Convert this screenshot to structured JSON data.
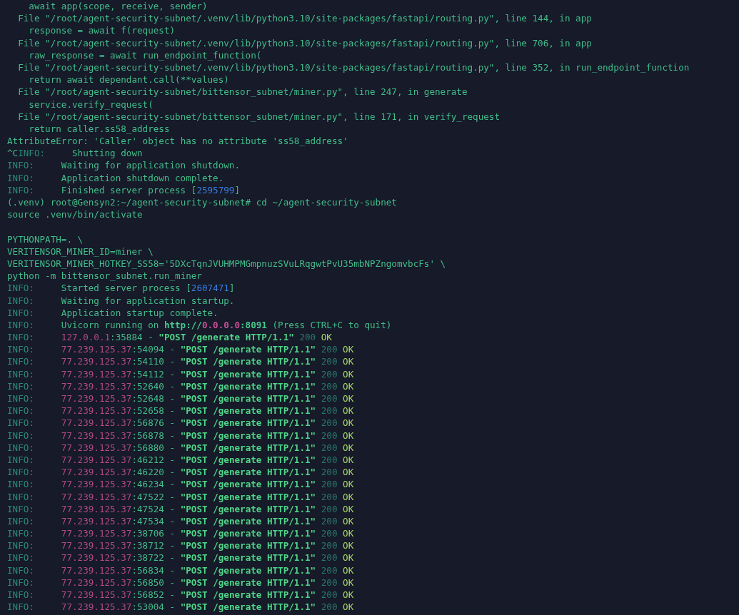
{
  "terminal": {
    "lines": [
      {
        "kind": "output",
        "segments": [
          {
            "kind": "text",
            "text": "    await app(scope, receive, sender)"
          }
        ]
      },
      {
        "kind": "output",
        "segments": [
          {
            "kind": "text",
            "text": "  File \"/root/agent-security-subnet/.venv/lib/python3.10/site-packages/fastapi/routing.py\", line 144, in app"
          }
        ]
      },
      {
        "kind": "output",
        "segments": [
          {
            "kind": "text",
            "text": "    response = await f(request)"
          }
        ]
      },
      {
        "kind": "output",
        "segments": [
          {
            "kind": "text",
            "text": "  File \"/root/agent-security-subnet/.venv/lib/python3.10/site-packages/fastapi/routing.py\", line 706, in app"
          }
        ]
      },
      {
        "kind": "output",
        "segments": [
          {
            "kind": "text",
            "text": "    raw_response = await run_endpoint_function("
          }
        ]
      },
      {
        "kind": "output",
        "segments": [
          {
            "kind": "text",
            "text": "  File \"/root/agent-security-subnet/.venv/lib/python3.10/site-packages/fastapi/routing.py\", line 352, in run_endpoint_function"
          }
        ]
      },
      {
        "kind": "output",
        "segments": [
          {
            "kind": "text",
            "text": "    return await dependant.call(**values)"
          }
        ]
      },
      {
        "kind": "output",
        "segments": [
          {
            "kind": "text",
            "text": "  File \"/root/agent-security-subnet/bittensor_subnet/miner.py\", line 247, in generate"
          }
        ]
      },
      {
        "kind": "output",
        "segments": [
          {
            "kind": "text",
            "text": "    service.verify_request("
          }
        ]
      },
      {
        "kind": "output",
        "segments": [
          {
            "kind": "text",
            "text": "  File \"/root/agent-security-subnet/bittensor_subnet/miner.py\", line 171, in verify_request"
          }
        ]
      },
      {
        "kind": "output",
        "segments": [
          {
            "kind": "text",
            "text": "    return caller.ss58_address"
          }
        ]
      },
      {
        "kind": "output",
        "segments": [
          {
            "kind": "text",
            "text": "AttributeError: 'Caller' object has no attribute 'ss58_address'"
          }
        ]
      },
      {
        "kind": "output",
        "segments": [
          {
            "kind": "text",
            "text": "^C"
          },
          {
            "kind": "level",
            "text": "INFO:"
          },
          {
            "kind": "text",
            "text": "Shutting down"
          }
        ]
      },
      {
        "kind": "output",
        "segments": [
          {
            "kind": "level",
            "text": "INFO:"
          },
          {
            "kind": "text",
            "text": "Waiting for application shutdown."
          }
        ]
      },
      {
        "kind": "output",
        "segments": [
          {
            "kind": "level",
            "text": "INFO:"
          },
          {
            "kind": "text",
            "text": "Application shutdown complete."
          }
        ]
      },
      {
        "kind": "output",
        "segments": [
          {
            "kind": "level",
            "text": "INFO:"
          },
          {
            "kind": "text",
            "text": "Finished server process ["
          },
          {
            "kind": "pid",
            "text": "2595799"
          },
          {
            "kind": "text",
            "text": "]"
          }
        ]
      },
      {
        "kind": "output",
        "segments": [
          {
            "kind": "text",
            "text": "(.venv) root@Gensyn2:~/agent-security-subnet# cd ~/agent-security-subnet"
          }
        ]
      },
      {
        "kind": "output",
        "segments": [
          {
            "kind": "text",
            "text": "source .venv/bin/activate"
          }
        ]
      },
      {
        "kind": "blank"
      },
      {
        "kind": "output",
        "segments": [
          {
            "kind": "text",
            "text": "PYTHONPATH=. \\"
          }
        ]
      },
      {
        "kind": "output",
        "segments": [
          {
            "kind": "text",
            "text": "VERITENSOR_MINER_ID=miner \\"
          }
        ]
      },
      {
        "kind": "output",
        "segments": [
          {
            "kind": "text",
            "text": "VERITENSOR_MINER_HOTKEY_SS58='5DXcTqnJVUHMPMGmpnuzSVuLRqgwtPvU35mbNPZngomvbcFs' \\"
          }
        ]
      },
      {
        "kind": "output",
        "segments": [
          {
            "kind": "text",
            "text": "python -m bittensor_subnet.run_miner"
          }
        ]
      },
      {
        "kind": "output",
        "segments": [
          {
            "kind": "level",
            "text": "INFO:"
          },
          {
            "kind": "text",
            "text": "Started server process ["
          },
          {
            "kind": "pid",
            "text": "2607471"
          },
          {
            "kind": "text",
            "text": "]"
          }
        ]
      },
      {
        "kind": "output",
        "segments": [
          {
            "kind": "level",
            "text": "INFO:"
          },
          {
            "kind": "text",
            "text": "Waiting for application startup."
          }
        ]
      },
      {
        "kind": "output",
        "segments": [
          {
            "kind": "level",
            "text": "INFO:"
          },
          {
            "kind": "text",
            "text": "Application startup complete."
          }
        ]
      },
      {
        "kind": "output",
        "segments": [
          {
            "kind": "level",
            "text": "INFO:"
          },
          {
            "kind": "text",
            "text": "Uvicorn running on "
          },
          {
            "kind": "url",
            "text": "http://"
          },
          {
            "kind": "host",
            "text": "0.0.0.0"
          },
          {
            "kind": "url",
            "text": ":8091"
          },
          {
            "kind": "text",
            "text": " (Press CTRL+C to quit)"
          }
        ]
      },
      {
        "kind": "output",
        "segments": [
          {
            "kind": "level",
            "text": "INFO:"
          },
          {
            "kind": "ip",
            "text": "127.0.0.1"
          },
          {
            "kind": "text",
            "text": ":35884 - "
          },
          {
            "kind": "request",
            "text": "\"POST /generate HTTP/1.1\""
          },
          {
            "kind": "code",
            "text": "200"
          },
          {
            "kind": "ok",
            "text": "OK"
          }
        ]
      },
      {
        "kind": "output",
        "segments": [
          {
            "kind": "level",
            "text": "INFO:"
          },
          {
            "kind": "ip",
            "text": "77.239.125.37"
          },
          {
            "kind": "text",
            "text": ":54094 - "
          },
          {
            "kind": "request",
            "text": "\"POST /generate HTTP/1.1\""
          },
          {
            "kind": "code",
            "text": "200"
          },
          {
            "kind": "ok",
            "text": "OK"
          }
        ]
      },
      {
        "kind": "output",
        "segments": [
          {
            "kind": "level",
            "text": "INFO:"
          },
          {
            "kind": "ip",
            "text": "77.239.125.37"
          },
          {
            "kind": "text",
            "text": ":54110 - "
          },
          {
            "kind": "request",
            "text": "\"POST /generate HTTP/1.1\""
          },
          {
            "kind": "code",
            "text": "200"
          },
          {
            "kind": "ok",
            "text": "OK"
          }
        ]
      },
      {
        "kind": "output",
        "segments": [
          {
            "kind": "level",
            "text": "INFO:"
          },
          {
            "kind": "ip",
            "text": "77.239.125.37"
          },
          {
            "kind": "text",
            "text": ":54112 - "
          },
          {
            "kind": "request",
            "text": "\"POST /generate HTTP/1.1\""
          },
          {
            "kind": "code",
            "text": "200"
          },
          {
            "kind": "ok",
            "text": "OK"
          }
        ]
      },
      {
        "kind": "output",
        "segments": [
          {
            "kind": "level",
            "text": "INFO:"
          },
          {
            "kind": "ip",
            "text": "77.239.125.37"
          },
          {
            "kind": "text",
            "text": ":52640 - "
          },
          {
            "kind": "request",
            "text": "\"POST /generate HTTP/1.1\""
          },
          {
            "kind": "code",
            "text": "200"
          },
          {
            "kind": "ok",
            "text": "OK"
          }
        ]
      },
      {
        "kind": "output",
        "segments": [
          {
            "kind": "level",
            "text": "INFO:"
          },
          {
            "kind": "ip",
            "text": "77.239.125.37"
          },
          {
            "kind": "text",
            "text": ":52648 - "
          },
          {
            "kind": "request",
            "text": "\"POST /generate HTTP/1.1\""
          },
          {
            "kind": "code",
            "text": "200"
          },
          {
            "kind": "ok",
            "text": "OK"
          }
        ]
      },
      {
        "kind": "output",
        "segments": [
          {
            "kind": "level",
            "text": "INFO:"
          },
          {
            "kind": "ip",
            "text": "77.239.125.37"
          },
          {
            "kind": "text",
            "text": ":52658 - "
          },
          {
            "kind": "request",
            "text": "\"POST /generate HTTP/1.1\""
          },
          {
            "kind": "code",
            "text": "200"
          },
          {
            "kind": "ok",
            "text": "OK"
          }
        ]
      },
      {
        "kind": "output",
        "segments": [
          {
            "kind": "level",
            "text": "INFO:"
          },
          {
            "kind": "ip",
            "text": "77.239.125.37"
          },
          {
            "kind": "text",
            "text": ":56876 - "
          },
          {
            "kind": "request",
            "text": "\"POST /generate HTTP/1.1\""
          },
          {
            "kind": "code",
            "text": "200"
          },
          {
            "kind": "ok",
            "text": "OK"
          }
        ]
      },
      {
        "kind": "output",
        "segments": [
          {
            "kind": "level",
            "text": "INFO:"
          },
          {
            "kind": "ip",
            "text": "77.239.125.37"
          },
          {
            "kind": "text",
            "text": ":56878 - "
          },
          {
            "kind": "request",
            "text": "\"POST /generate HTTP/1.1\""
          },
          {
            "kind": "code",
            "text": "200"
          },
          {
            "kind": "ok",
            "text": "OK"
          }
        ]
      },
      {
        "kind": "output",
        "segments": [
          {
            "kind": "level",
            "text": "INFO:"
          },
          {
            "kind": "ip",
            "text": "77.239.125.37"
          },
          {
            "kind": "text",
            "text": ":56880 - "
          },
          {
            "kind": "request",
            "text": "\"POST /generate HTTP/1.1\""
          },
          {
            "kind": "code",
            "text": "200"
          },
          {
            "kind": "ok",
            "text": "OK"
          }
        ]
      },
      {
        "kind": "output",
        "segments": [
          {
            "kind": "level",
            "text": "INFO:"
          },
          {
            "kind": "ip",
            "text": "77.239.125.37"
          },
          {
            "kind": "text",
            "text": ":46212 - "
          },
          {
            "kind": "request",
            "text": "\"POST /generate HTTP/1.1\""
          },
          {
            "kind": "code",
            "text": "200"
          },
          {
            "kind": "ok",
            "text": "OK"
          }
        ]
      },
      {
        "kind": "output",
        "segments": [
          {
            "kind": "level",
            "text": "INFO:"
          },
          {
            "kind": "ip",
            "text": "77.239.125.37"
          },
          {
            "kind": "text",
            "text": ":46220 - "
          },
          {
            "kind": "request",
            "text": "\"POST /generate HTTP/1.1\""
          },
          {
            "kind": "code",
            "text": "200"
          },
          {
            "kind": "ok",
            "text": "OK"
          }
        ]
      },
      {
        "kind": "output",
        "segments": [
          {
            "kind": "level",
            "text": "INFO:"
          },
          {
            "kind": "ip",
            "text": "77.239.125.37"
          },
          {
            "kind": "text",
            "text": ":46234 - "
          },
          {
            "kind": "request",
            "text": "\"POST /generate HTTP/1.1\""
          },
          {
            "kind": "code",
            "text": "200"
          },
          {
            "kind": "ok",
            "text": "OK"
          }
        ]
      },
      {
        "kind": "output",
        "segments": [
          {
            "kind": "level",
            "text": "INFO:"
          },
          {
            "kind": "ip",
            "text": "77.239.125.37"
          },
          {
            "kind": "text",
            "text": ":47522 - "
          },
          {
            "kind": "request",
            "text": "\"POST /generate HTTP/1.1\""
          },
          {
            "kind": "code",
            "text": "200"
          },
          {
            "kind": "ok",
            "text": "OK"
          }
        ]
      },
      {
        "kind": "output",
        "segments": [
          {
            "kind": "level",
            "text": "INFO:"
          },
          {
            "kind": "ip",
            "text": "77.239.125.37"
          },
          {
            "kind": "text",
            "text": ":47524 - "
          },
          {
            "kind": "request",
            "text": "\"POST /generate HTTP/1.1\""
          },
          {
            "kind": "code",
            "text": "200"
          },
          {
            "kind": "ok",
            "text": "OK"
          }
        ]
      },
      {
        "kind": "output",
        "segments": [
          {
            "kind": "level",
            "text": "INFO:"
          },
          {
            "kind": "ip",
            "text": "77.239.125.37"
          },
          {
            "kind": "text",
            "text": ":47534 - "
          },
          {
            "kind": "request",
            "text": "\"POST /generate HTTP/1.1\""
          },
          {
            "kind": "code",
            "text": "200"
          },
          {
            "kind": "ok",
            "text": "OK"
          }
        ]
      },
      {
        "kind": "output",
        "segments": [
          {
            "kind": "level",
            "text": "INFO:"
          },
          {
            "kind": "ip",
            "text": "77.239.125.37"
          },
          {
            "kind": "text",
            "text": ":38706 - "
          },
          {
            "kind": "request",
            "text": "\"POST /generate HTTP/1.1\""
          },
          {
            "kind": "code",
            "text": "200"
          },
          {
            "kind": "ok",
            "text": "OK"
          }
        ]
      },
      {
        "kind": "output",
        "segments": [
          {
            "kind": "level",
            "text": "INFO:"
          },
          {
            "kind": "ip",
            "text": "77.239.125.37"
          },
          {
            "kind": "text",
            "text": ":38712 - "
          },
          {
            "kind": "request",
            "text": "\"POST /generate HTTP/1.1\""
          },
          {
            "kind": "code",
            "text": "200"
          },
          {
            "kind": "ok",
            "text": "OK"
          }
        ]
      },
      {
        "kind": "output",
        "segments": [
          {
            "kind": "level",
            "text": "INFO:"
          },
          {
            "kind": "ip",
            "text": "77.239.125.37"
          },
          {
            "kind": "text",
            "text": ":38722 - "
          },
          {
            "kind": "request",
            "text": "\"POST /generate HTTP/1.1\""
          },
          {
            "kind": "code",
            "text": "200"
          },
          {
            "kind": "ok",
            "text": "OK"
          }
        ]
      },
      {
        "kind": "output",
        "segments": [
          {
            "kind": "level",
            "text": "INFO:"
          },
          {
            "kind": "ip",
            "text": "77.239.125.37"
          },
          {
            "kind": "text",
            "text": ":56834 - "
          },
          {
            "kind": "request",
            "text": "\"POST /generate HTTP/1.1\""
          },
          {
            "kind": "code",
            "text": "200"
          },
          {
            "kind": "ok",
            "text": "OK"
          }
        ]
      },
      {
        "kind": "output",
        "segments": [
          {
            "kind": "level",
            "text": "INFO:"
          },
          {
            "kind": "ip",
            "text": "77.239.125.37"
          },
          {
            "kind": "text",
            "text": ":56850 - "
          },
          {
            "kind": "request",
            "text": "\"POST /generate HTTP/1.1\""
          },
          {
            "kind": "code",
            "text": "200"
          },
          {
            "kind": "ok",
            "text": "OK"
          }
        ]
      },
      {
        "kind": "output",
        "segments": [
          {
            "kind": "level",
            "text": "INFO:"
          },
          {
            "kind": "ip",
            "text": "77.239.125.37"
          },
          {
            "kind": "text",
            "text": ":56852 - "
          },
          {
            "kind": "request",
            "text": "\"POST /generate HTTP/1.1\""
          },
          {
            "kind": "code",
            "text": "200"
          },
          {
            "kind": "ok",
            "text": "OK"
          }
        ]
      },
      {
        "kind": "output",
        "segments": [
          {
            "kind": "level",
            "text": "INFO:"
          },
          {
            "kind": "ip",
            "text": "77.239.125.37"
          },
          {
            "kind": "text",
            "text": ":53004 - "
          },
          {
            "kind": "request",
            "text": "\"POST /generate HTTP/1.1\""
          },
          {
            "kind": "code",
            "text": "200"
          },
          {
            "kind": "ok",
            "text": "OK"
          }
        ]
      }
    ]
  }
}
